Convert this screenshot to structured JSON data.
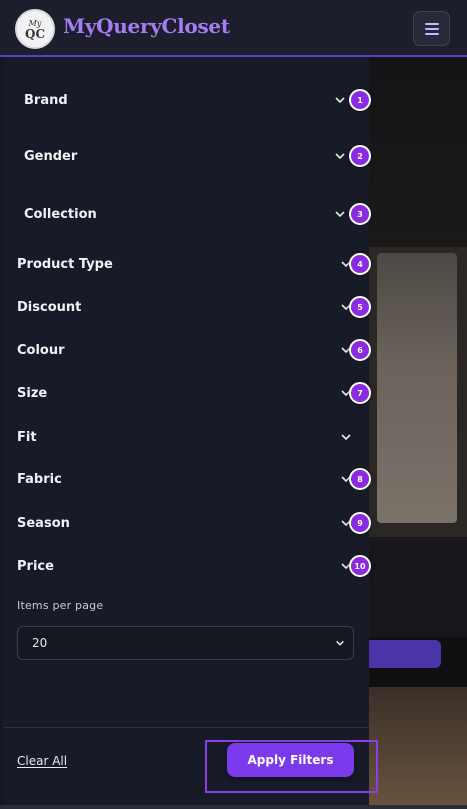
{
  "header": {
    "brand": "MyQueryCloset",
    "logo_text_top": "My",
    "logo_text_bottom": "QC",
    "menu_icon": "hamburger-icon"
  },
  "filters": [
    {
      "label": "Brand",
      "badge": "1"
    },
    {
      "label": "Gender",
      "badge": "2"
    },
    {
      "label": "Collection",
      "badge": "3"
    },
    {
      "label": "Product Type",
      "badge": "4"
    },
    {
      "label": "Discount",
      "badge": "5"
    },
    {
      "label": "Colour",
      "badge": "6"
    },
    {
      "label": "Size",
      "badge": "7"
    },
    {
      "label": "Fit",
      "badge": ""
    },
    {
      "label": "Fabric",
      "badge": "8"
    },
    {
      "label": "Season",
      "badge": "9"
    },
    {
      "label": "Price",
      "badge": "10"
    }
  ],
  "items_per_page": {
    "label": "Items per page",
    "value": "20"
  },
  "footer": {
    "clear_all": "Clear All",
    "apply": "Apply Filters"
  },
  "colors": {
    "accent": "#7c3aed",
    "badge": "#8a2be2",
    "brand": "#a57cf2",
    "panel_bg": "#171b27"
  }
}
